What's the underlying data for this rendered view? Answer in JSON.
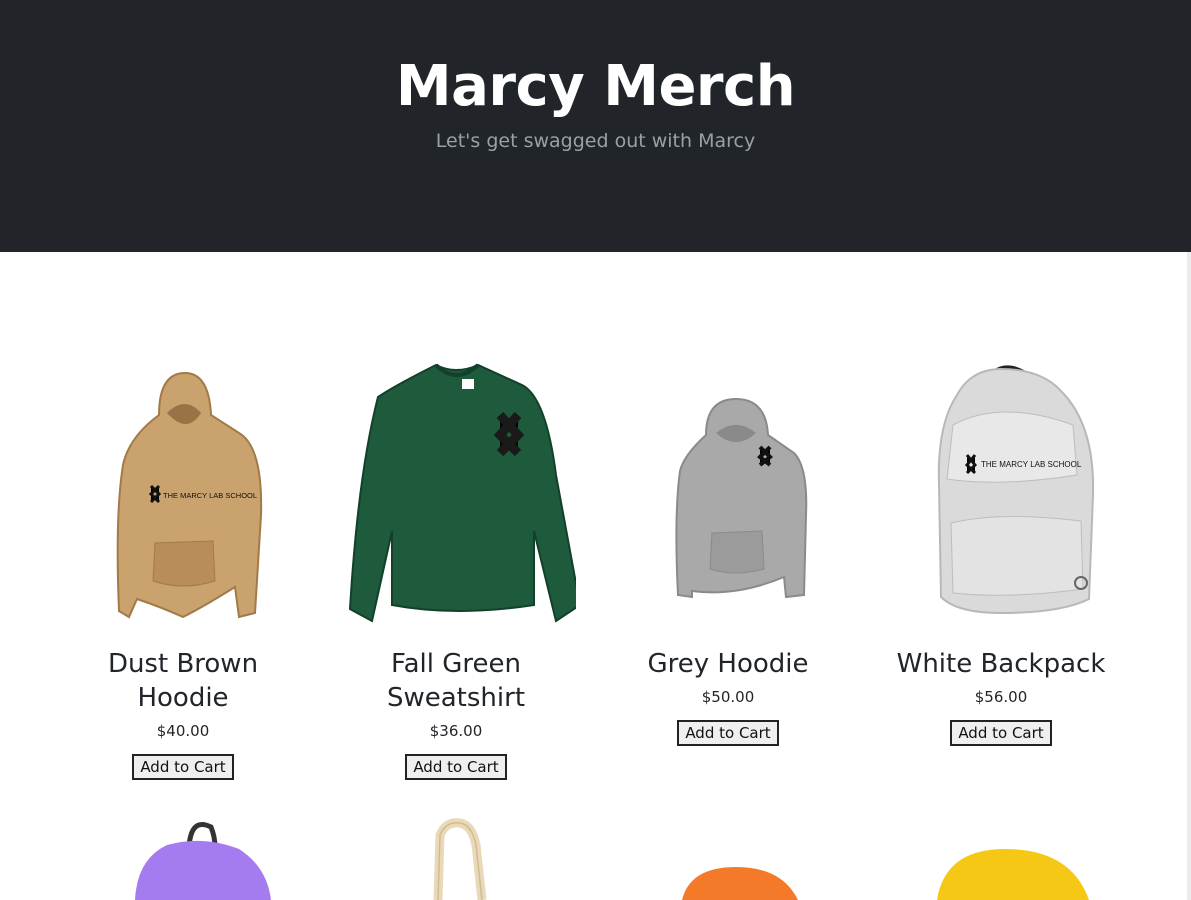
{
  "header": {
    "title": "Marcy Merch",
    "subtitle": "Let's get swagged out with Marcy"
  },
  "products": [
    {
      "name": "Dust Brown Hoodie",
      "price": "$40.00",
      "button": "Add to Cart",
      "color": "#C9A26E",
      "image": "hoodie-icon"
    },
    {
      "name": "Fall Green Sweatshirt",
      "price": "$36.00",
      "button": "Add to Cart",
      "color": "#1E5A3C",
      "image": "sweatshirt-icon"
    },
    {
      "name": "Grey Hoodie",
      "price": "$50.00",
      "button": "Add to Cart",
      "color": "#A9A9A9",
      "image": "hoodie-icon"
    },
    {
      "name": "White Backpack",
      "price": "$56.00",
      "button": "Add to Cart",
      "color": "#DADADA",
      "image": "backpack-icon"
    }
  ],
  "next_row": [
    {
      "image": "backpack-icon",
      "color": "#A57CF0"
    },
    {
      "image": "tote-bag-icon",
      "color": "#EAD9B8"
    },
    {
      "image": "beanie-icon",
      "color": "#F47A2A"
    },
    {
      "image": "beanie-icon",
      "color": "#F5C816"
    }
  ],
  "logo_text": "THE MARCY LAB SCHOOL"
}
